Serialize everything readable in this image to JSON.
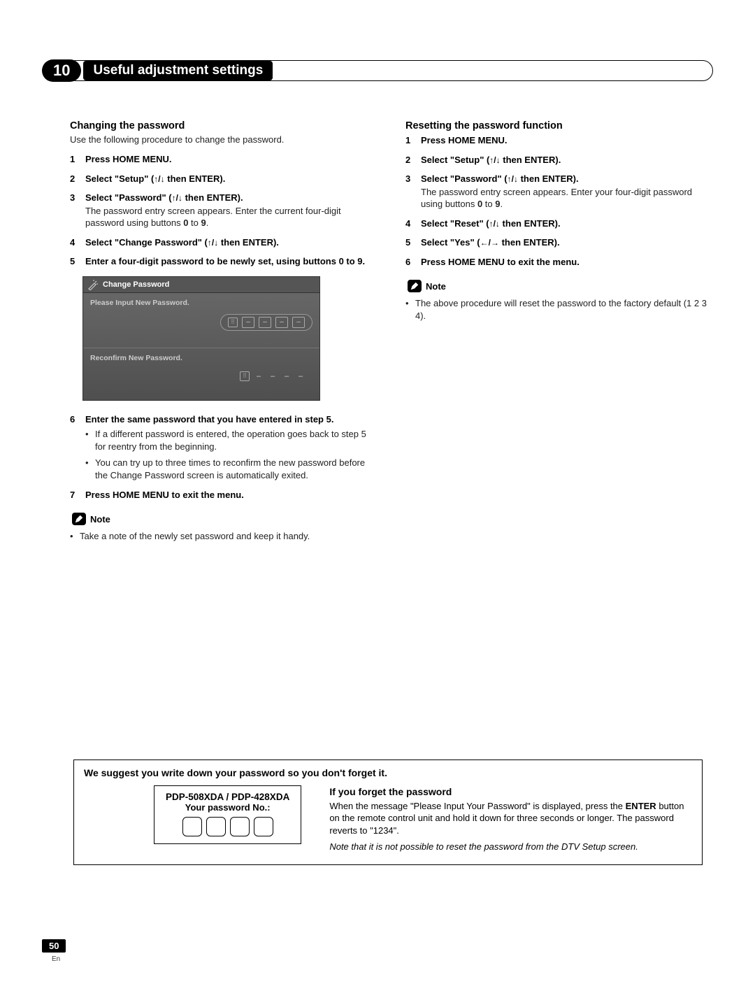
{
  "chapter": {
    "number": "10",
    "title": "Useful adjustment settings"
  },
  "left": {
    "title": "Changing the password",
    "intro": "Use the following procedure to change the password.",
    "steps": [
      {
        "t": "Press HOME MENU."
      },
      {
        "t": "Select \"Setup\" (",
        "arrows": "↑/↓",
        "after": " then ENTER)."
      },
      {
        "t": "Select \"Password\" (",
        "arrows": "↑/↓",
        "after": " then ENTER).",
        "note": "The password entry screen appears. Enter the current four-digit password using buttons ",
        "bold1": "0",
        "mid": " to ",
        "bold2": "9",
        "end": "."
      },
      {
        "t": "Select \"Change Password\" (",
        "arrows": "↑/↓",
        "after": " then ENTER)."
      },
      {
        "t": "Enter a four-digit password to be newly set, using buttons 0 to 9.",
        "fullbold": true
      },
      {
        "t": "Enter the same password that you have entered in step 5.",
        "bullets": [
          "If a different password is entered, the operation goes back to step 5 for reentry from the beginning.",
          "You can try up to three times to reconfirm the new password before the Change Password screen is automatically exited."
        ]
      },
      {
        "t": "Press HOME MENU to exit the menu."
      }
    ],
    "osd": {
      "header": "Change Password",
      "label1": "Please Input New Password.",
      "label2": "Reconfirm New Password."
    },
    "noteLabel": "Note",
    "noteItems": [
      "Take a note of the newly set password and keep it handy."
    ]
  },
  "right": {
    "title": "Resetting the password function",
    "steps": [
      {
        "t": "Press HOME MENU."
      },
      {
        "t": "Select \"Setup\" (",
        "arrows": "↑/↓",
        "after": " then ENTER)."
      },
      {
        "t": "Select \"Password\" (",
        "arrows": "↑/↓",
        "after": " then ENTER).",
        "note": "The password entry screen appears. Enter your four-digit password using buttons ",
        "bold1": "0",
        "mid": " to ",
        "bold2": "9",
        "end": "."
      },
      {
        "t": "Select \"Reset\" (",
        "arrows": "↑/↓",
        "after": " then ENTER)."
      },
      {
        "t": "Select \"Yes\" (",
        "arrows": "←/→",
        "after": " then ENTER)."
      },
      {
        "t": "Press HOME MENU to exit the menu."
      }
    ],
    "noteLabel": "Note",
    "noteItems": [
      "The above procedure will reset the password to the factory default (1 2 3 4)."
    ]
  },
  "suggest": {
    "title": "We suggest you write down your password so you don't forget it.",
    "model": "PDP-508XDA / PDP-428XDA",
    "yourpw": "Your password No.:",
    "forgetTitle": "If you forget the password",
    "forgetBody1": "When the message \"Please Input Your Password\" is displayed, press the ",
    "enter": "ENTER",
    "forgetBody2": " button on the remote control unit and hold it down for three seconds or longer. The password reverts to \"1234\".",
    "forgetNote": "Note that it is not possible to reset the password from the DTV Setup screen."
  },
  "page": {
    "num": "50",
    "lang": "En"
  }
}
